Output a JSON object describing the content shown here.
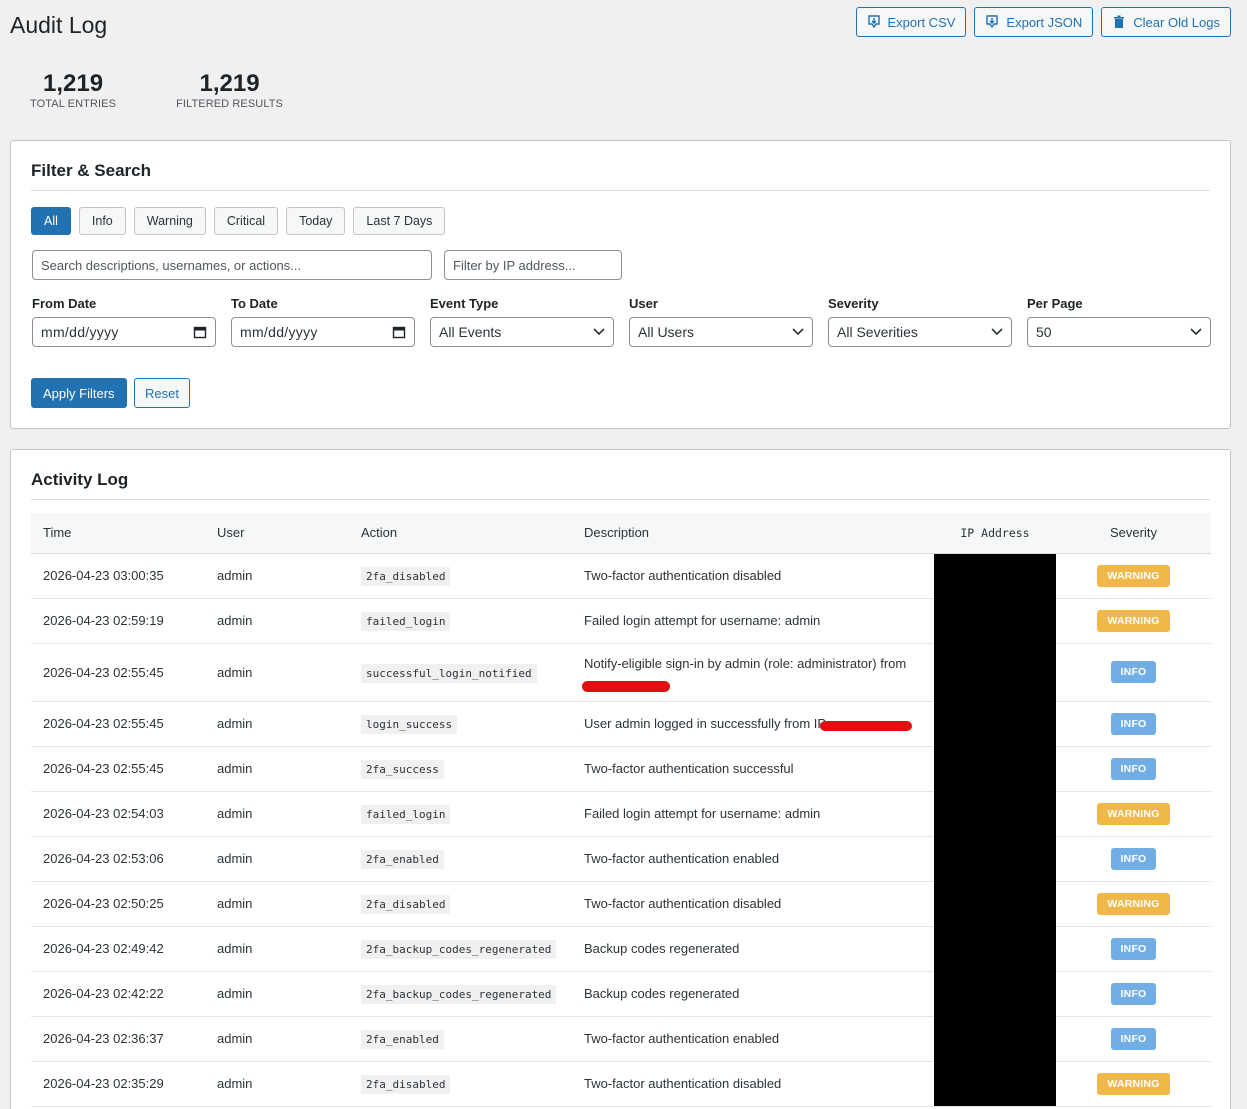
{
  "header": {
    "title": "Audit Log",
    "export_csv": "Export CSV",
    "export_json": "Export JSON",
    "clear_old_logs": "Clear Old Logs"
  },
  "stats": {
    "total_value": "1,219",
    "total_label": "TOTAL ENTRIES",
    "filtered_value": "1,219",
    "filtered_label": "FILTERED RESULTS"
  },
  "filter": {
    "title": "Filter & Search",
    "chips": [
      "All",
      "Info",
      "Warning",
      "Critical",
      "Today",
      "Last 7 Days"
    ],
    "active_chip": "All",
    "search_placeholder": "Search descriptions, usernames, or actions...",
    "ip_placeholder": "Filter by IP address...",
    "from_date_label": "From Date",
    "from_date_value": "mm/dd/yyyy",
    "to_date_label": "To Date",
    "to_date_value": "mm/dd/yyyy",
    "event_type_label": "Event Type",
    "event_type_value": "All Events",
    "user_label": "User",
    "user_value": "All Users",
    "severity_label": "Severity",
    "severity_value": "All Severities",
    "per_page_label": "Per Page",
    "per_page_value": "50",
    "apply_label": "Apply Filters",
    "reset_label": "Reset"
  },
  "log": {
    "title": "Activity Log",
    "columns": {
      "time": "Time",
      "user": "User",
      "action": "Action",
      "description": "Description",
      "ip": "IP Address",
      "severity": "Severity"
    },
    "rows": [
      {
        "time": "2026-04-23 03:00:35",
        "user": "admin",
        "action": "2fa_disabled",
        "description": "Two-factor authentication disabled",
        "severity": "WARNING"
      },
      {
        "time": "2026-04-23 02:59:19",
        "user": "admin",
        "action": "failed_login",
        "description": "Failed login attempt for username: admin",
        "severity": "WARNING"
      },
      {
        "time": "2026-04-23 02:55:45",
        "user": "admin",
        "action": "successful_login_notified",
        "description": "Notify-eligible sign-in by admin (role: administrator) from",
        "severity": "INFO"
      },
      {
        "time": "2026-04-23 02:55:45",
        "user": "admin",
        "action": "login_success",
        "description": "User admin logged in successfully from IP",
        "severity": "INFO"
      },
      {
        "time": "2026-04-23 02:55:45",
        "user": "admin",
        "action": "2fa_success",
        "description": "Two-factor authentication successful",
        "severity": "INFO"
      },
      {
        "time": "2026-04-23 02:54:03",
        "user": "admin",
        "action": "failed_login",
        "description": "Failed login attempt for username: admin",
        "severity": "WARNING"
      },
      {
        "time": "2026-04-23 02:53:06",
        "user": "admin",
        "action": "2fa_enabled",
        "description": "Two-factor authentication enabled",
        "severity": "INFO"
      },
      {
        "time": "2026-04-23 02:50:25",
        "user": "admin",
        "action": "2fa_disabled",
        "description": "Two-factor authentication disabled",
        "severity": "WARNING"
      },
      {
        "time": "2026-04-23 02:49:42",
        "user": "admin",
        "action": "2fa_backup_codes_regenerated",
        "description": "Backup codes regenerated",
        "severity": "INFO"
      },
      {
        "time": "2026-04-23 02:42:22",
        "user": "admin",
        "action": "2fa_backup_codes_regenerated",
        "description": "Backup codes regenerated",
        "severity": "INFO"
      },
      {
        "time": "2026-04-23 02:36:37",
        "user": "admin",
        "action": "2fa_enabled",
        "description": "Two-factor authentication enabled",
        "severity": "INFO"
      },
      {
        "time": "2026-04-23 02:35:29",
        "user": "admin",
        "action": "2fa_disabled",
        "description": "Two-factor authentication disabled",
        "severity": "WARNING"
      }
    ]
  },
  "colors": {
    "primary": "#2271b1",
    "warning": "#f0b849",
    "info": "#72aee6",
    "redaction": "#e01010"
  }
}
